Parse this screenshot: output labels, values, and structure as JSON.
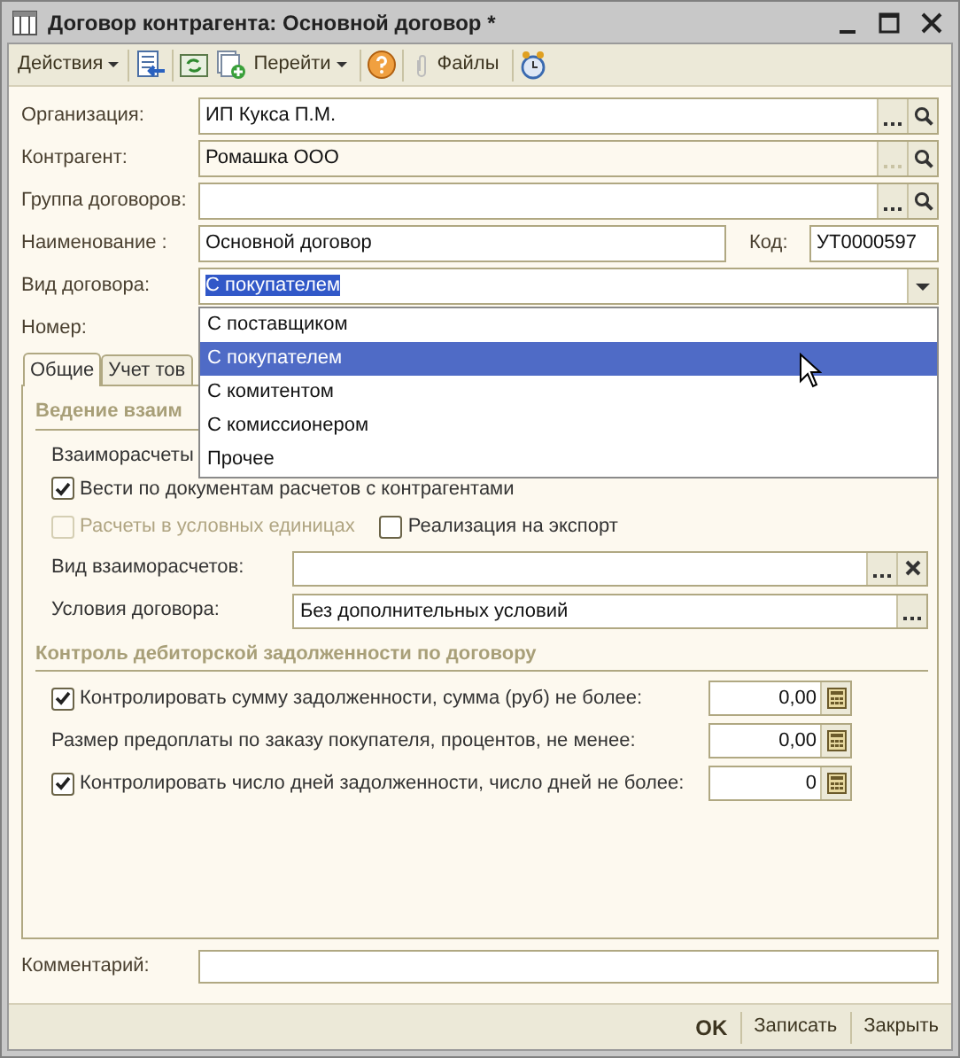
{
  "window": {
    "title": "Договор контрагента: Основной договор *"
  },
  "toolbar": {
    "actions_menu": "Действия",
    "goto_menu": "Перейти",
    "files_button": "Файлы"
  },
  "header_fields": [
    {
      "label": "Организация:",
      "value": "ИП Кукса П.М.",
      "readonly": false
    },
    {
      "label": "Контрагент:",
      "value": "Ромашка ООО",
      "readonly": true
    },
    {
      "label": "Группа договоров:",
      "readonly": false
    }
  ],
  "name_field": {
    "label": "Наименование :",
    "value": "Основной договор"
  },
  "code_field": {
    "label": "Код:",
    "value": "УТ0000597"
  },
  "contract_type": {
    "label": "Вид договора:",
    "value": "С покупателем",
    "expanded": true,
    "options": [
      {
        "label": "С поставщиком",
        "selected": false
      },
      {
        "label": "С покупателем",
        "selected": true
      },
      {
        "label": "С комитентом",
        "selected": false
      },
      {
        "label": "С комиссионером",
        "selected": false
      },
      {
        "label": "Прочее",
        "selected": false
      }
    ]
  },
  "number_label": "Номер:",
  "tabs": [
    {
      "label": "Общие",
      "selected": true
    },
    {
      "label": "Учет тов",
      "selected": false
    }
  ],
  "settlements_section": {
    "title": "Ведение взаим",
    "settlements_label": "Взаиморасчеты",
    "checkboxes": [
      {
        "label": "Вести по документам расчетов с контрагентами",
        "checked": true,
        "disabled": false
      },
      {
        "label": "Расчеты в условных единицах",
        "checked": false,
        "disabled": true
      },
      {
        "label": "Реализация на экспорт",
        "checked": false,
        "disabled": false
      }
    ],
    "fields": [
      {
        "label": "Вид взаиморасчетов:",
        "kind": "clearable"
      },
      {
        "label": "Условия договора:",
        "value": "Без дополнительных условий",
        "kind": "select"
      }
    ]
  },
  "debt_section": {
    "title": "Контроль дебиторской задолженности по договору",
    "limits": [
      {
        "kind": "checkbox",
        "label": "Контролировать сумму задолженности, сумма (руб) не более:",
        "checked": true,
        "value": "0,00"
      },
      {
        "kind": "plain",
        "label": "Размер предоплаты по заказу покупателя, процентов, не менее:",
        "value": "0,00"
      },
      {
        "kind": "checkbox",
        "label": "Контролировать число дней задолженности, число дней не более:",
        "checked": true,
        "value": "0"
      }
    ]
  },
  "comment": {
    "label": "Комментарий:"
  },
  "footer_buttons": [
    {
      "label": "OK",
      "default": true
    },
    {
      "label": "Записать",
      "default": false
    },
    {
      "label": "Закрыть",
      "default": false
    }
  ]
}
